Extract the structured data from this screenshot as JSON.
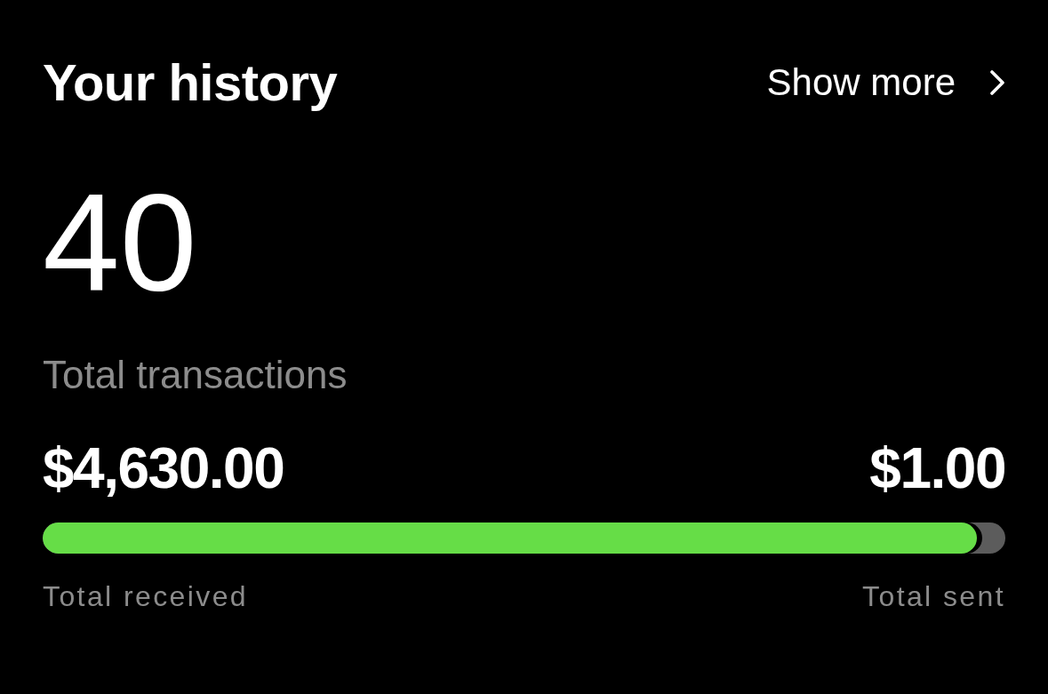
{
  "header": {
    "title": "Your history",
    "link": {
      "label": "Show more"
    }
  },
  "summary": {
    "count": "40",
    "count_label": "Total transactions"
  },
  "balance": {
    "received_amount": "$4,630.00",
    "sent_amount": "$1.00",
    "level": 0.97,
    "received_label": "Total received",
    "sent_label": "Total sent"
  }
}
